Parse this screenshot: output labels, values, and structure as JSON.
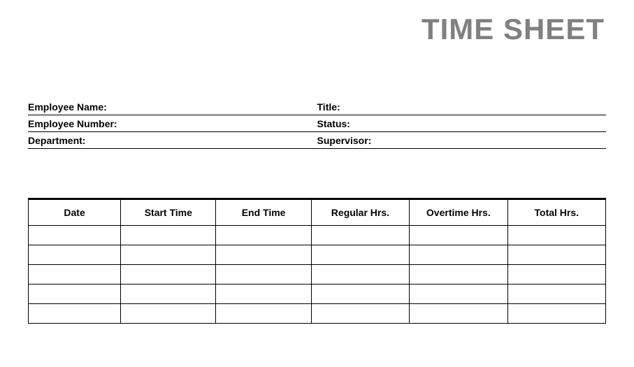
{
  "document": {
    "title": "TIME SHEET"
  },
  "info_fields": {
    "employee_name_label": "Employee Name:",
    "title_label": "Title:",
    "employee_number_label": "Employee Number:",
    "status_label": "Status:",
    "department_label": "Department:",
    "supervisor_label": "Supervisor:"
  },
  "table": {
    "headers": {
      "date": "Date",
      "start_time": "Start Time",
      "end_time": "End Time",
      "regular_hrs": "Regular Hrs.",
      "overtime_hrs": "Overtime Hrs.",
      "total_hrs": "Total Hrs."
    },
    "rows": [
      {
        "date": "",
        "start_time": "",
        "end_time": "",
        "regular_hrs": "",
        "overtime_hrs": "",
        "total_hrs": ""
      },
      {
        "date": "",
        "start_time": "",
        "end_time": "",
        "regular_hrs": "",
        "overtime_hrs": "",
        "total_hrs": ""
      },
      {
        "date": "",
        "start_time": "",
        "end_time": "",
        "regular_hrs": "",
        "overtime_hrs": "",
        "total_hrs": ""
      },
      {
        "date": "",
        "start_time": "",
        "end_time": "",
        "regular_hrs": "",
        "overtime_hrs": "",
        "total_hrs": ""
      },
      {
        "date": "",
        "start_time": "",
        "end_time": "",
        "regular_hrs": "",
        "overtime_hrs": "",
        "total_hrs": ""
      }
    ]
  }
}
